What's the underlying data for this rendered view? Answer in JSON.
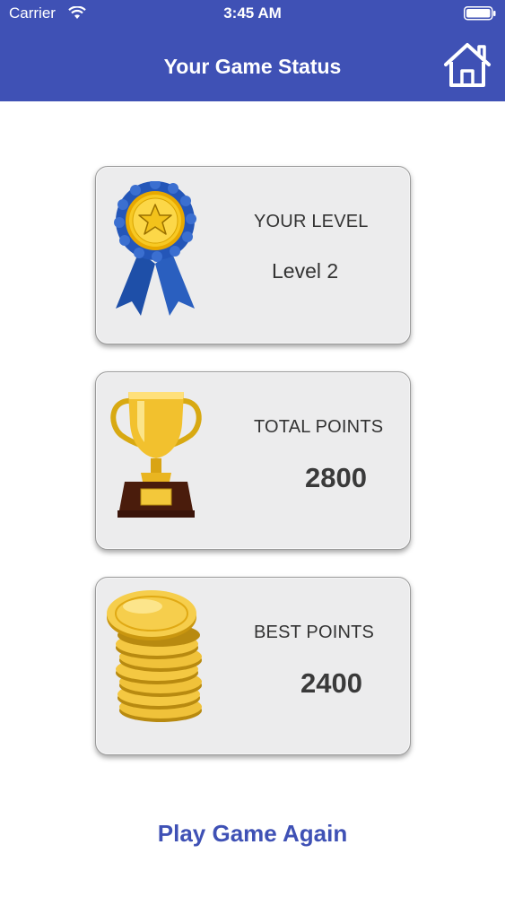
{
  "status_bar": {
    "carrier": "Carrier",
    "time": "3:45 AM"
  },
  "header": {
    "title": "Your Game Status",
    "home_icon": "home-icon"
  },
  "cards": [
    {
      "label": "YOUR LEVEL",
      "value": "Level 2",
      "icon": "ribbon-icon"
    },
    {
      "label": "TOTAL POINTS",
      "value": "2800",
      "icon": "trophy-icon"
    },
    {
      "label": "BEST POINTS",
      "value": "2400",
      "icon": "coins-icon"
    }
  ],
  "footer": {
    "play_again_label": "Play Game Again"
  },
  "colors": {
    "accent": "#3f51b5",
    "card_bg": "#ececed"
  }
}
